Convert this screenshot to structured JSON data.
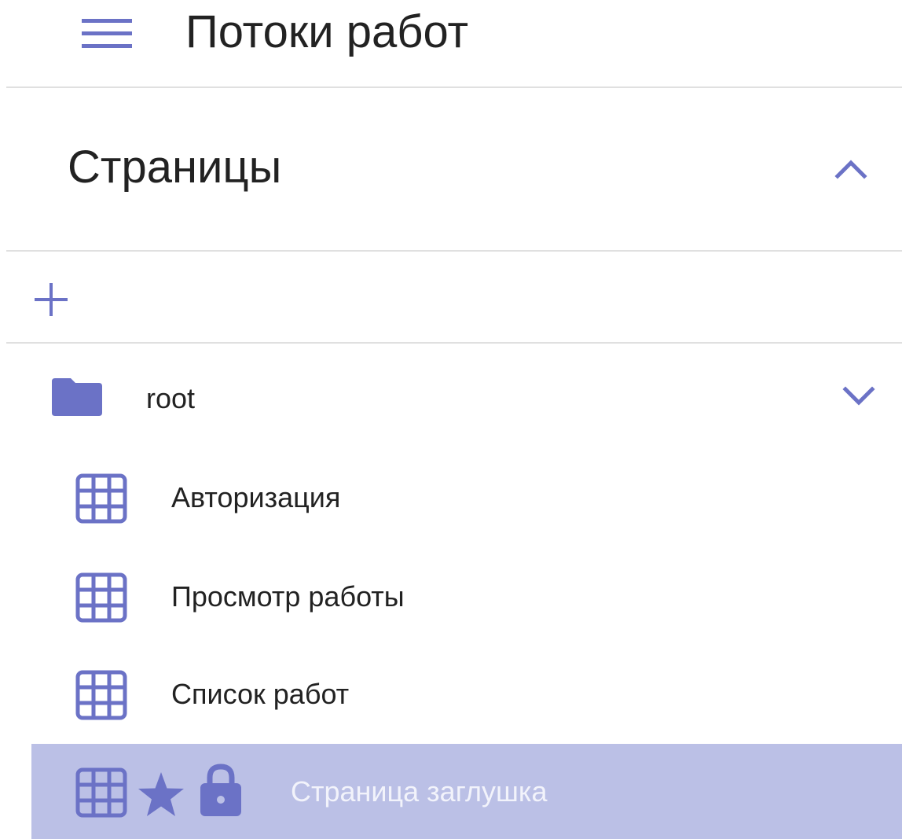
{
  "header": {
    "menu_icon": "hamburger-menu-icon",
    "title": "Потоки работ"
  },
  "pages_section": {
    "title": "Страницы",
    "collapse_icon": "chevron-up-icon",
    "add_icon": "plus-icon"
  },
  "tree": {
    "folder": {
      "icon": "folder-icon",
      "label": "root",
      "expand_icon": "chevron-down-icon"
    },
    "items": [
      {
        "icon": "grid-icon",
        "label": "Авторизация",
        "selected": false
      },
      {
        "icon": "grid-icon",
        "label": "Просмотр работы",
        "selected": false
      },
      {
        "icon": "grid-icon",
        "label": "Список работ",
        "selected": false
      },
      {
        "icon": "grid-icon",
        "extra_icons": [
          "star-icon",
          "lock-icon"
        ],
        "label": "Страница заглушка",
        "selected": true
      }
    ]
  },
  "colors": {
    "accent": "#6b72c6",
    "selected_background": "#bbc0e6",
    "selected_text": "#f2f3fb",
    "text": "#222222",
    "divider": "#e0e0e0"
  }
}
